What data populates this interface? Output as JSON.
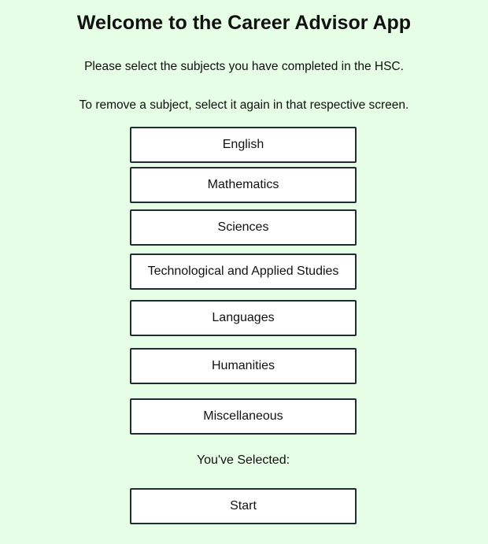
{
  "header": {
    "title": "Welcome to the Career Advisor App"
  },
  "instructions": {
    "select": "Please select the subjects you have completed in the HSC.",
    "remove": "To remove a subject, select it again in that respective screen."
  },
  "subjects": [
    {
      "label": "English"
    },
    {
      "label": "Mathematics"
    },
    {
      "label": "Sciences"
    },
    {
      "label": "Technological and Applied Studies"
    },
    {
      "label": "Languages"
    },
    {
      "label": "Humanities"
    },
    {
      "label": "Miscellaneous"
    }
  ],
  "selection": {
    "label": "You've Selected:"
  },
  "actions": {
    "start_label": "Start"
  }
}
